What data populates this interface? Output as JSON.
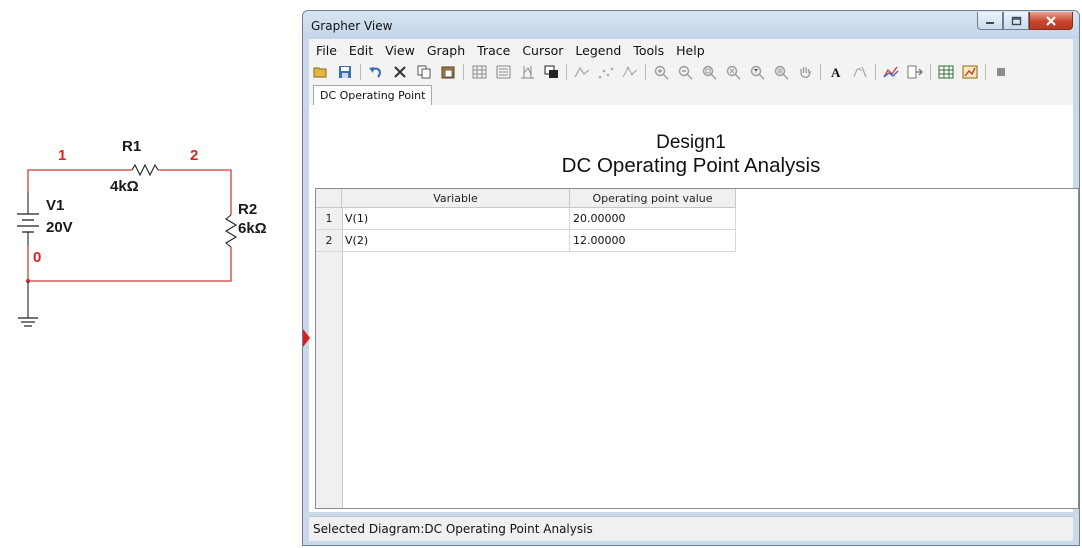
{
  "schematic": {
    "node_1": "1",
    "node_2": "2",
    "node_0": "0",
    "r1_name": "R1",
    "r1_value": "4kΩ",
    "r2_name": "R2",
    "r2_value": "6kΩ",
    "v1_name": "V1",
    "v1_value": "20V"
  },
  "window": {
    "title": "Grapher View",
    "menu": [
      "File",
      "Edit",
      "View",
      "Graph",
      "Trace",
      "Cursor",
      "Legend",
      "Tools",
      "Help"
    ],
    "tab": "DC Operating Point",
    "design_title": "Design1",
    "analysis_title": "DC Operating Point Analysis",
    "status": "Selected Diagram:DC Operating Point Analysis"
  },
  "table": {
    "columns": [
      "Variable",
      "Operating point value"
    ],
    "rows": [
      {
        "index": "1",
        "variable": "V(1)",
        "value": "20.00000"
      },
      {
        "index": "2",
        "variable": "V(2)",
        "value": "12.00000"
      }
    ]
  },
  "colors": {
    "wire": "#d23a3a",
    "node_label": "#dd2222",
    "title_bar": "#c9d9ea",
    "close_button": "#c8452c"
  }
}
